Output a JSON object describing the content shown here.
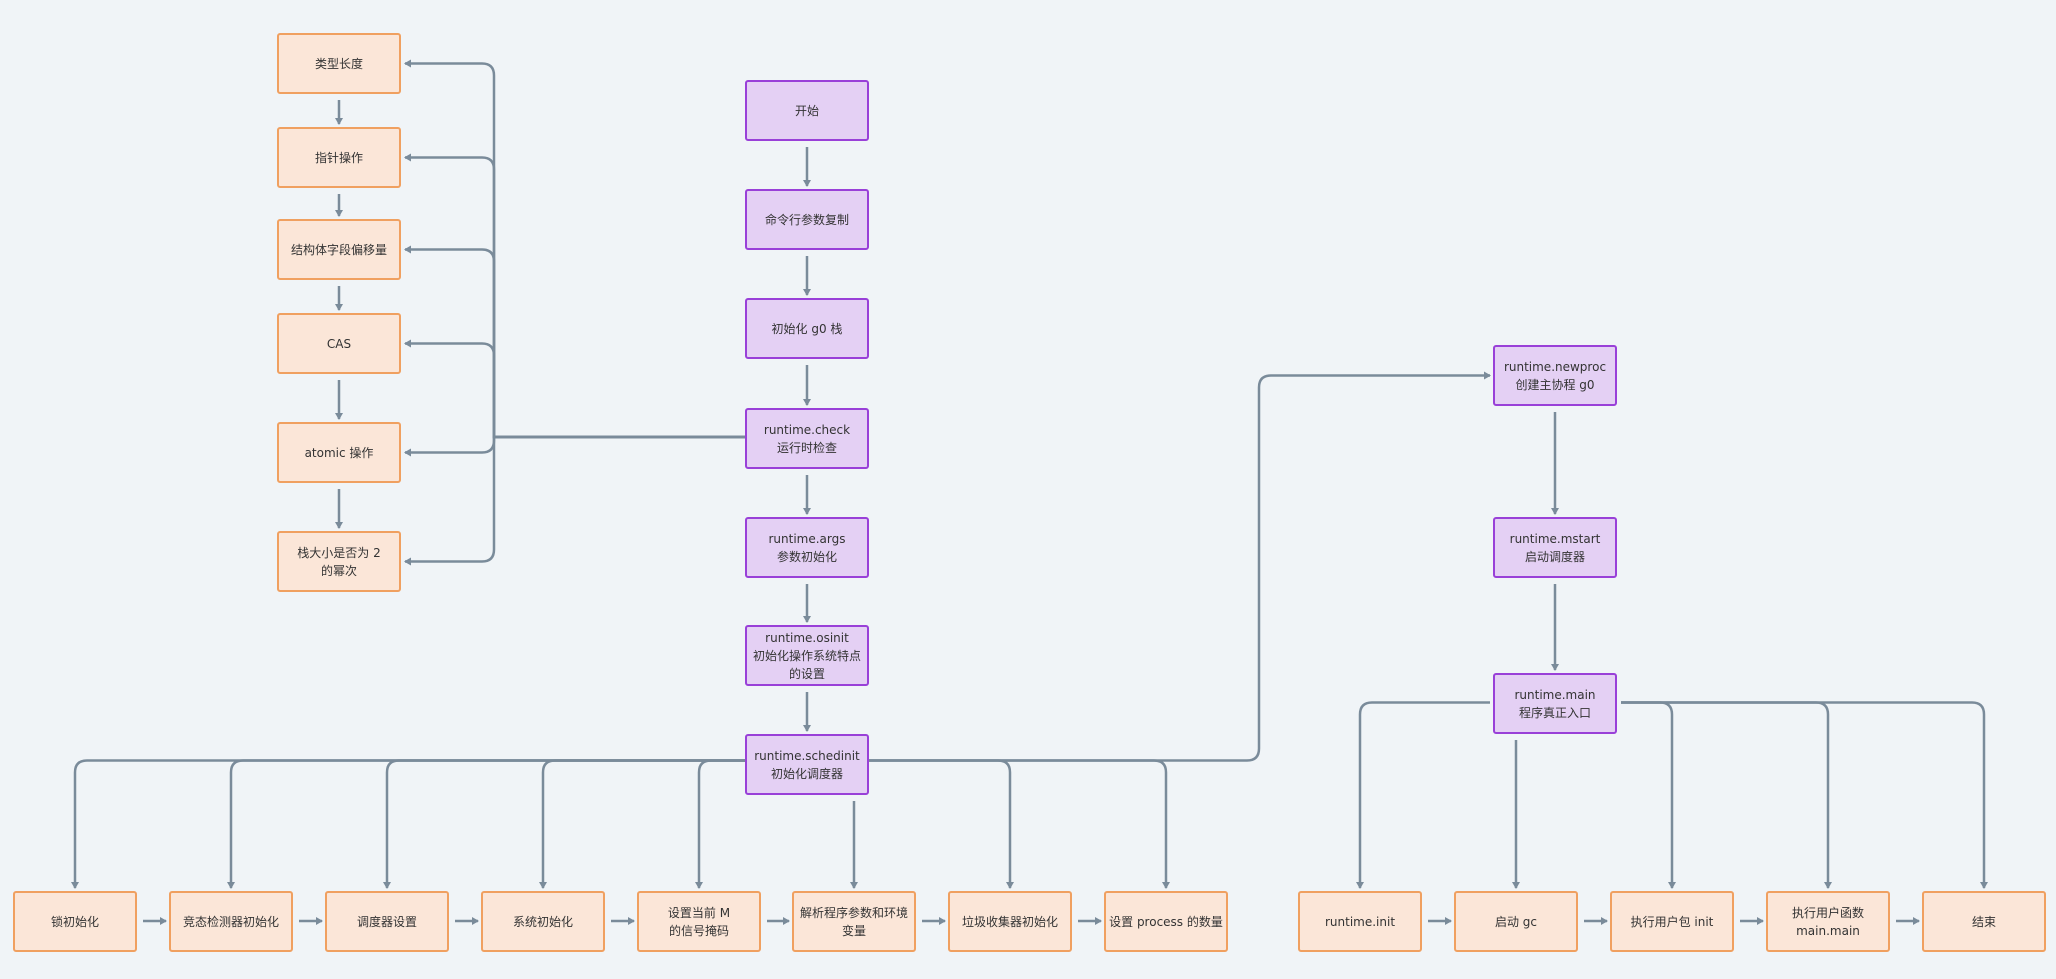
{
  "colors": {
    "background": "#f0f4f7",
    "edge": "#7a8b9a",
    "orange_fill": "#fbe6d8",
    "orange_border": "#f0a060",
    "purple_fill": "#e4d0f4",
    "purple_border": "#9940d8"
  },
  "check_items": [
    {
      "id": "l0",
      "lines": [
        "类型长度"
      ]
    },
    {
      "id": "l1",
      "lines": [
        "指针操作"
      ]
    },
    {
      "id": "l2",
      "lines": [
        "结构体字段偏移量"
      ]
    },
    {
      "id": "l3",
      "lines": [
        "CAS"
      ]
    },
    {
      "id": "l4",
      "lines": [
        "atomic 操作"
      ]
    },
    {
      "id": "l5",
      "lines": [
        "栈大小是否为 2",
        "的幂次"
      ]
    }
  ],
  "main_flow": [
    {
      "id": "c0",
      "lines": [
        "开始"
      ]
    },
    {
      "id": "c1",
      "lines": [
        "命令行参数复制"
      ]
    },
    {
      "id": "c2",
      "lines": [
        "初始化 g0 栈"
      ]
    },
    {
      "id": "c3",
      "lines": [
        "runtime.check",
        "运行时检查"
      ]
    },
    {
      "id": "c4",
      "lines": [
        "runtime.args",
        "参数初始化"
      ]
    },
    {
      "id": "c5",
      "lines": [
        "runtime.osinit",
        "初始化操作系统特点",
        "的设置"
      ]
    },
    {
      "id": "c6",
      "lines": [
        "runtime.schedinit",
        "初始化调度器"
      ]
    }
  ],
  "schedinit_steps": [
    {
      "id": "b0",
      "lines": [
        "锁初始化"
      ]
    },
    {
      "id": "b1",
      "lines": [
        "竞态检测器初始化"
      ]
    },
    {
      "id": "b2",
      "lines": [
        "调度器设置"
      ]
    },
    {
      "id": "b3",
      "lines": [
        "系统初始化"
      ]
    },
    {
      "id": "b4",
      "lines": [
        "设置当前 M",
        "的信号掩码"
      ]
    },
    {
      "id": "b5",
      "lines": [
        "解析程序参数和环境",
        "变量"
      ]
    },
    {
      "id": "b6",
      "lines": [
        "垃圾收集器初始化"
      ]
    },
    {
      "id": "b7",
      "lines": [
        "设置 process 的数量"
      ]
    }
  ],
  "runtime_flow": [
    {
      "id": "r0",
      "lines": [
        "runtime.newproc",
        "创建主协程 g0"
      ]
    },
    {
      "id": "r1",
      "lines": [
        "runtime.mstart",
        "启动调度器"
      ]
    },
    {
      "id": "r2",
      "lines": [
        "runtime.main",
        "程序真正入口"
      ]
    }
  ],
  "main_steps": [
    {
      "id": "m0",
      "lines": [
        "runtime.init"
      ]
    },
    {
      "id": "m1",
      "lines": [
        "启动 gc"
      ]
    },
    {
      "id": "m2",
      "lines": [
        "执行用户包 init"
      ]
    },
    {
      "id": "m3",
      "lines": [
        "执行用户函数",
        "main.main"
      ]
    },
    {
      "id": "m4",
      "lines": [
        "结束"
      ]
    }
  ]
}
